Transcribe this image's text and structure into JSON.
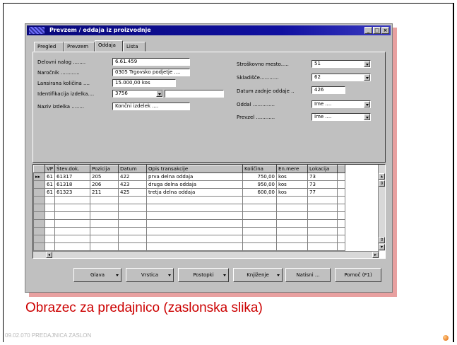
{
  "window": {
    "title": "Prevzem / oddaja iz proizvodnje",
    "minimize": "_",
    "maximize": "□",
    "close": "×"
  },
  "tabs": [
    {
      "label": "Pregled"
    },
    {
      "label": "Prevzem"
    },
    {
      "label": "Oddaja"
    },
    {
      "label": "Lista"
    }
  ],
  "active_tab": "Oddaja",
  "form_left": [
    {
      "label": "Delovni nalog ........",
      "value": "6.61.459"
    },
    {
      "label": "Naročnik ............",
      "value": "0305 Trgovsko podjetje ...."
    },
    {
      "label": "Lansirana količina ....",
      "value": "15.000,00 kos"
    },
    {
      "label": "Identifikacija izdelka....",
      "value": "3756",
      "value2": ""
    },
    {
      "label": "Naziv izdelka ........",
      "value": "Končni izdelek ...."
    }
  ],
  "form_right": [
    {
      "label": "Stroškovno mesto.....",
      "value": "51"
    },
    {
      "label": "Skladišče............",
      "value": "62"
    },
    {
      "label": "Datum zadnje oddaje ..",
      "value": "426"
    },
    {
      "label": "Oddal ..............",
      "value": "Ime ...."
    },
    {
      "label": "Prevzel ............",
      "value": "Ime ...."
    }
  ],
  "grid": {
    "columns": [
      "VP",
      "Štev.dok.",
      "Pozicija",
      "Datum",
      "Opis transakcije",
      "Količina",
      "En.mere",
      "Lokacija"
    ],
    "rows": [
      [
        "61",
        "61317",
        "205",
        "422",
        "prva delna oddaja",
        "750,00",
        "kos",
        "73"
      ],
      [
        "61",
        "61318",
        "206",
        "423",
        "druga delna oddaja",
        "950,00",
        "kos",
        "73"
      ],
      [
        "61",
        "61323",
        "211",
        "425",
        "tretja delna oddaja",
        "600,00",
        "kos",
        "77"
      ]
    ],
    "current_row_marker": "▸▸"
  },
  "buttons": [
    {
      "label": "Glava"
    },
    {
      "label": "Vrstica"
    },
    {
      "label": "Postopki"
    },
    {
      "label": "Knjiženje"
    },
    {
      "label": "Natisni ..."
    },
    {
      "label": "Pomoč (F1)"
    }
  ],
  "caption": "Obrazec za predajnico (zaslonska slika)",
  "footer": "09.02.070 PREDAJNICA ZASLON",
  "colors": {
    "caption": "#cc0000",
    "titlebar": "#0a0a7a",
    "shadow": "#e8a0a0"
  }
}
